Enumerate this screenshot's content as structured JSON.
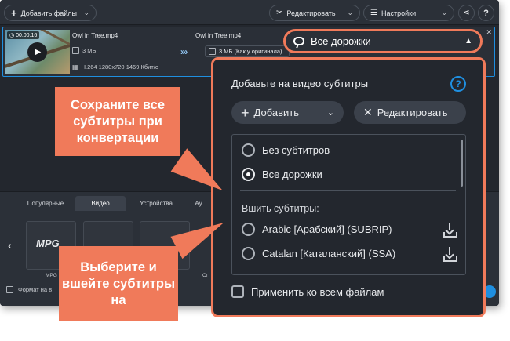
{
  "toolbar": {
    "add_files_label": "Добавить файлы",
    "edit_label": "Редактировать",
    "settings_label": "Настройки"
  },
  "file": {
    "duration": "00:00:16",
    "input_name": "Owl in Tree.mp4",
    "input_size": "3 МБ",
    "input_specs": "H.264 1280x720 1469 Кбит/с",
    "output_name": "Owl in Tree.mp4",
    "output_size": "3 МБ (Как у оригинала)"
  },
  "subtitle_tracks_button": {
    "label": "Все дорожки"
  },
  "subtitles_popover": {
    "title": "Добавьте на видео субтитры",
    "add_label": "Добавить",
    "edit_label": "Редактировать",
    "options": [
      {
        "label": "Без субтитров",
        "selected": false
      },
      {
        "label": "Все дорожки",
        "selected": true
      }
    ],
    "burn_section_label": "Вшить субтитры:",
    "burn_tracks": [
      {
        "label": "Arabic [Арабский] (SUBRIP)"
      },
      {
        "label": "Catalan [Каталанский] (SSA)"
      }
    ],
    "apply_all_label": "Применить ко всем файлам",
    "apply_all_checked": false
  },
  "format_panel": {
    "tabs": [
      "Популярные",
      "Видео",
      "Устройства",
      "Ау"
    ],
    "active_tab": "Видео",
    "presets": [
      {
        "label": "MPG"
      },
      {
        "label": ""
      },
      {
        "label": "Ог"
      }
    ],
    "format_row_label": "Формат на в"
  },
  "callouts": {
    "keep_subtitles": "Сохраните все субтитры при конвертации",
    "burn_subtitles": "Выберите и вшейте субтитры на"
  },
  "colors": {
    "accent_blue": "#1f8fe0",
    "callout_orange": "#f07a5a",
    "panel_dark": "#23272e"
  }
}
